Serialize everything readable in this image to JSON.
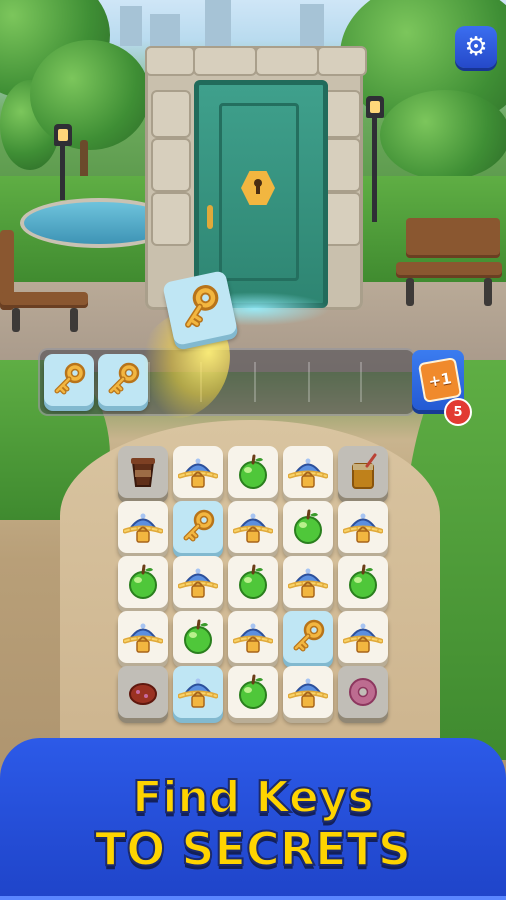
{
  "game": {
    "settings_icon": "gear-icon",
    "door_lock_icon": "keyhole-icon",
    "booster": {
      "label": "+1",
      "count": "5"
    },
    "banner": {
      "line1": "Find Keys",
      "line2": "TO SECRETS"
    },
    "tray_items": [
      "key",
      "key"
    ],
    "flying_tile": "key",
    "board": {
      "rows": [
        [
          "coffee",
          "cloche-chain",
          "apple",
          "cloche-chain",
          "juice"
        ],
        [
          "cloche-chain",
          "key",
          "cloche-chain",
          "apple",
          "cloche-chain"
        ],
        [
          "apple",
          "cloche-chain",
          "apple",
          "cloche-chain",
          "apple"
        ],
        [
          "cloche-chain",
          "apple",
          "cloche-chain",
          "key",
          "cloche-chain"
        ],
        [
          "food-item",
          "cloche-chain",
          "apple",
          "cloche-chain",
          "donut"
        ]
      ]
    }
  }
}
